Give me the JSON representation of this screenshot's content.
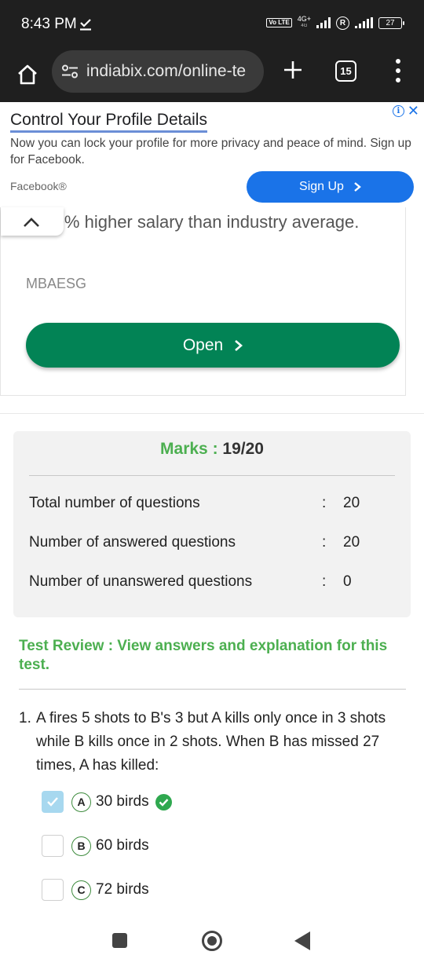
{
  "status_bar": {
    "time": "8:43 PM",
    "network_top": "4G+",
    "network_sub": "4G",
    "volte": "Vo LTE",
    "roaming": "R",
    "battery": "27"
  },
  "browser": {
    "url": "indiabix.com/online-te",
    "tab_count": "15"
  },
  "ad": {
    "title": "Control Your Profile Details",
    "description": "Now you can lock your profile for more privacy and peace of mind. Sign up for Facebook.",
    "brand": "Facebook®",
    "cta_label": "Sign Up",
    "info_label": "i",
    "close_label": "✕"
  },
  "ad_card": {
    "text": "4. 20% higher salary than industry average.",
    "brand": "MBAESG",
    "open_label": "Open"
  },
  "results": {
    "marks_label": "Marks :",
    "marks_value": "19/20",
    "rows": [
      {
        "label": "Total number of questions",
        "colon": ":",
        "value": "20"
      },
      {
        "label": "Number of answered questions",
        "colon": ":",
        "value": "20"
      },
      {
        "label": "Number of unanswered questions",
        "colon": ":",
        "value": "0"
      }
    ]
  },
  "review": {
    "title": "Test Review : View answers and explanation for this test."
  },
  "question": {
    "number": "1.",
    "text": "A fires 5 shots to B's 3 but A kills only once in 3 shots while B kills once in 2 shots. When B has missed 27 times, A has killed:",
    "options": [
      {
        "letter": "A",
        "text": "30 birds",
        "selected": true,
        "correct": true
      },
      {
        "letter": "B",
        "text": "60 birds",
        "selected": false,
        "correct": false
      },
      {
        "letter": "C",
        "text": "72 birds",
        "selected": false,
        "correct": false
      }
    ]
  },
  "colors": {
    "accent_green": "#4caf50",
    "open_button": "#028355",
    "ad_cta": "#1a73e8",
    "checkbox_selected": "#a7d8ef"
  }
}
